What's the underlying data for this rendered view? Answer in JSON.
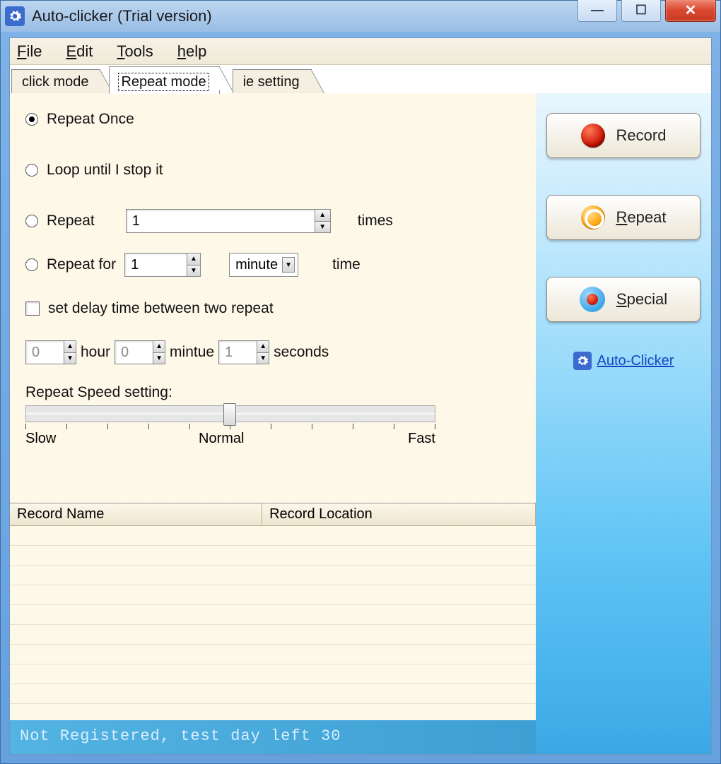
{
  "window": {
    "title": "Auto-clicker (Trial version)"
  },
  "menubar": {
    "file": "File",
    "edit": "Edit",
    "tools": "Tools",
    "help": "help"
  },
  "tabs": {
    "click_mode": "click mode",
    "repeat_mode": "Repeat mode",
    "ie_setting": "ie setting"
  },
  "repeat": {
    "once": "Repeat Once",
    "loop": "Loop until I stop it",
    "repeat_n_label": "Repeat",
    "repeat_n_value": "1",
    "repeat_n_suffix": "times",
    "repeat_for_label": "Repeat for",
    "repeat_for_value": "1",
    "repeat_for_unit": "minute",
    "repeat_for_suffix": "time",
    "delay_checkbox_label": "set delay time between two repeat",
    "delay_hour_value": "0",
    "delay_hour_label": "hour",
    "delay_minute_value": "0",
    "delay_minute_label": "mintue",
    "delay_seconds_value": "1",
    "delay_seconds_label": "seconds",
    "speed_label": "Repeat Speed setting:",
    "speed_slow": "Slow",
    "speed_normal": "Normal",
    "speed_fast": "Fast"
  },
  "buttons": {
    "record": "Record",
    "repeat": "Repeat",
    "special": "Special"
  },
  "link": {
    "auto_clicker": "Auto-Clicker"
  },
  "table": {
    "col1": "Record Name",
    "col2": "Record Location"
  },
  "status": {
    "text": "Not Registered, test day left 30"
  }
}
